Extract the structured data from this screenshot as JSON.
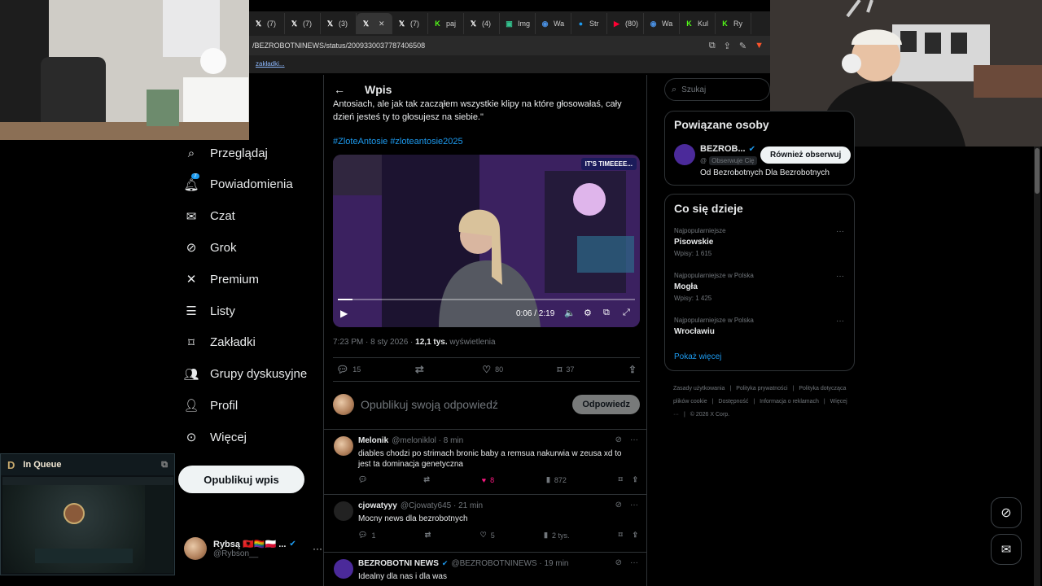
{
  "browser": {
    "tabs": [
      {
        "label": "(7)",
        "icon": "x-logo"
      },
      {
        "label": "(7)",
        "icon": "x-logo"
      },
      {
        "label": "(3)",
        "icon": "x-logo"
      },
      {
        "label": "",
        "icon": "x-logo",
        "active": true
      },
      {
        "label": "(7)",
        "icon": "x-logo"
      },
      {
        "label": "paj",
        "icon": "kick-logo"
      },
      {
        "label": "(4)",
        "icon": "x-logo"
      },
      {
        "label": "Img",
        "icon": "imgsli-logo"
      },
      {
        "label": "Wa",
        "icon": "wave-logo"
      },
      {
        "label": "Str",
        "icon": "globe-icon"
      },
      {
        "label": "(80)",
        "icon": "youtube-logo"
      },
      {
        "label": "Wa",
        "icon": "wave-logo"
      },
      {
        "label": "Kul",
        "icon": "kick-logo"
      },
      {
        "label": "Ry",
        "icon": "kick-logo"
      }
    ],
    "url": "/BEZROBOTNINEWS/status/2009330037787406508",
    "bookmark": "zakładki..."
  },
  "nav": {
    "items": [
      {
        "label": "Przeglądaj",
        "icon": "search-icon"
      },
      {
        "label": "Powiadomienia",
        "icon": "bell-icon",
        "badge": "7"
      },
      {
        "label": "Czat",
        "icon": "mail-icon"
      },
      {
        "label": "Grok",
        "icon": "grok-icon"
      },
      {
        "label": "Premium",
        "icon": "x-logo-icon"
      },
      {
        "label": "Listy",
        "icon": "list-icon"
      },
      {
        "label": "Zakładki",
        "icon": "bookmark-icon"
      },
      {
        "label": "Grupy dyskusyjne",
        "icon": "people-icon"
      },
      {
        "label": "Profil",
        "icon": "person-icon"
      },
      {
        "label": "Więcej",
        "icon": "more-circle-icon"
      }
    ],
    "post_button": "Opublikuj wpis",
    "me": {
      "name": "Rybsą 🇦🇱🏳️‍🌈🇵🇱 ...",
      "handle": "@Rybson__"
    }
  },
  "queue": {
    "title": "In Queue"
  },
  "post": {
    "header": "Wpis",
    "text_line1": "Antosiach, ale jak tak zacząłem wszystkie klipy na które głosowałaś, cały",
    "text_line2": "dzień jesteś ty to głosujesz na siebie.\"",
    "hashtags": "#ZloteAntosie #zloteantosie2025",
    "video_badge": "IT'S TIMEEEE...",
    "video_time": "0:06 / 2:19",
    "video_progress": 0.05,
    "meta_time": "7:23 PM · 8 sty 2026 · ",
    "views_value": "12,1 tys.",
    "views_label": " wyświetlenia",
    "stats": {
      "replies": "15",
      "reposts": "",
      "likes": "80",
      "bookmarks": "37"
    },
    "reply_placeholder": "Opublikuj swoją odpowiedź",
    "reply_button": "Odpowiedz"
  },
  "replies": [
    {
      "name": "Melonik",
      "handle": "@meloniklol · 8 min",
      "text": "diables chodzi po strimach bronic baby a remsua nakurwia w zeusa xd to jest ta dominacja genetyczna",
      "replies": "",
      "reposts": "",
      "likes": "8",
      "views": "872",
      "liked": true
    },
    {
      "name": "cjowatyyy",
      "handle": "@Cjowaty645 · 21 min",
      "text": "Mocny news dla bezrobotnych",
      "replies": "1",
      "reposts": "",
      "likes": "5",
      "views": "2 tys.",
      "liked": false
    },
    {
      "name": "BEZROBOTNI NEWS",
      "handle": "@BEZROBOTNINEWS · 19 min",
      "text": "Idealny dla nas i dla was",
      "verified": true
    }
  ],
  "right": {
    "search_placeholder": "Szukaj",
    "related_title": "Powiązane osoby",
    "related_name": "BEZROB...",
    "related_handle": "@",
    "related_follows_you": "Obserwuje Cię",
    "related_button": "Również obserwuj",
    "related_bio": "Od Bezrobotnych Dla Bezrobotnych",
    "trends_title": "Co się dzieje",
    "trends": [
      {
        "category": "Najpopularniejsze",
        "name": "Pisowskie",
        "count": "Wpisy: 1 615"
      },
      {
        "category": "Najpopularniejsze w Polska",
        "name": "Mogła",
        "count": "Wpisy: 1 425"
      },
      {
        "category": "Najpopularniejsze w Polska",
        "name": "Wrocławiu",
        "count": ""
      }
    ],
    "show_more": "Pokaż więcej",
    "footer": [
      "Zasady użytkowania",
      "Polityka prywatności",
      "Polityka dotycząca plików cookie",
      "Dostępność",
      "Informacja o reklamach",
      "Więcej ···",
      "© 2026 X Corp."
    ]
  },
  "colors": {
    "accent": "#1d9bf0",
    "like": "#f91880",
    "bg": "#000000",
    "border": "#2f3336"
  }
}
